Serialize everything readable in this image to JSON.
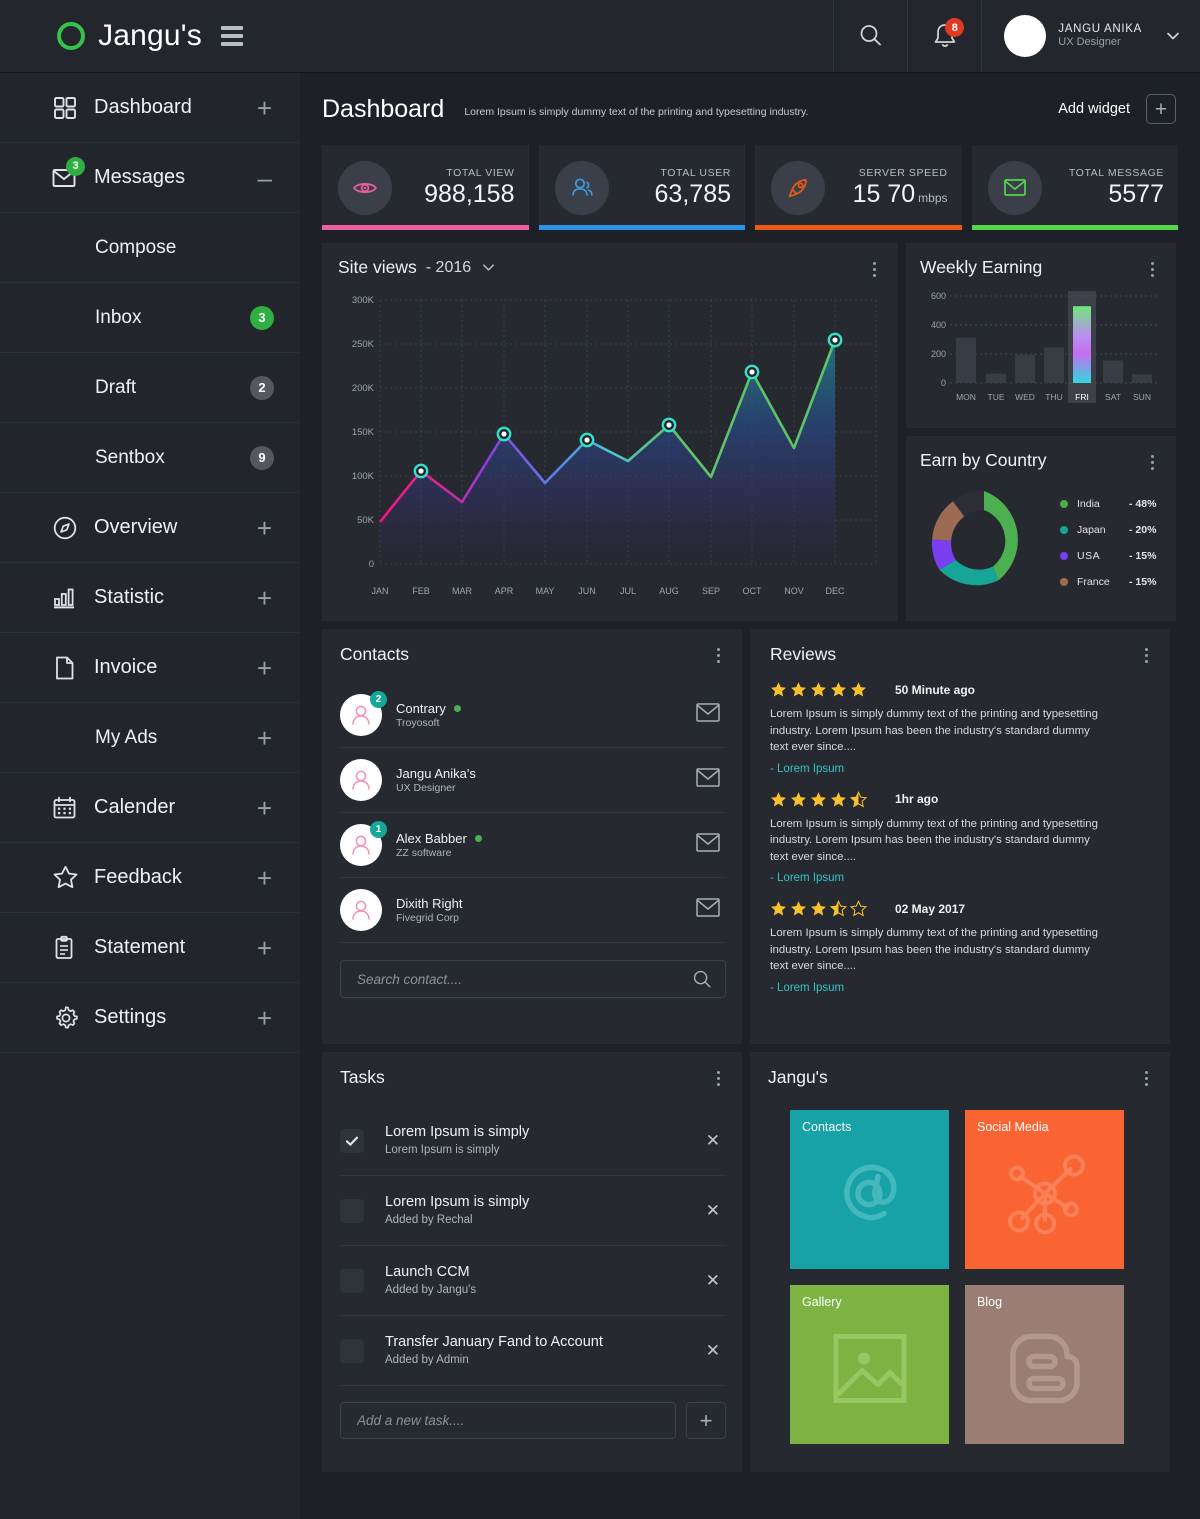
{
  "brand": {
    "name": "Jangu's",
    "logo_icon": "circle-logo",
    "menu_icon": "hamburger-icon"
  },
  "topbar": {
    "search_icon": "search-icon",
    "bell_icon": "bell-icon",
    "notification_count": "8",
    "user_name": "JANGU ANIKA",
    "user_role": "UX Designer",
    "chevron_icon": "chevron-down-icon"
  },
  "sidebar": {
    "items": [
      {
        "label": "Dashboard",
        "icon": "grid-icon",
        "action": "+"
      },
      {
        "label": "Messages",
        "icon": "envelope-icon",
        "action": "–",
        "badge": "3"
      },
      {
        "label": "Compose",
        "icon": "",
        "action": ""
      },
      {
        "label": "Inbox",
        "icon": "",
        "action": "",
        "badge": "3",
        "badge_style": "green"
      },
      {
        "label": "Draft",
        "icon": "",
        "action": "",
        "badge": "2",
        "badge_style": "grey"
      },
      {
        "label": "Sentbox",
        "icon": "",
        "action": "",
        "badge": "9",
        "badge_style": "grey"
      },
      {
        "label": "Overview",
        "icon": "compass-icon",
        "action": "+"
      },
      {
        "label": "Statistic",
        "icon": "bar-chart-icon",
        "action": "+"
      },
      {
        "label": "Invoice",
        "icon": "document-icon",
        "action": "+"
      },
      {
        "label": "My Ads",
        "icon": "",
        "action": "+"
      },
      {
        "label": "Calender",
        "icon": "calendar-icon",
        "action": "+"
      },
      {
        "label": "Feedback",
        "icon": "star-icon",
        "action": "+"
      },
      {
        "label": "Statement",
        "icon": "clipboard-icon",
        "action": "+"
      },
      {
        "label": "Settings",
        "icon": "gear-icon",
        "action": "+"
      }
    ]
  },
  "page": {
    "title": "Dashboard",
    "subtitle": "Lorem Ipsum is simply dummy text of the printing and typesetting industry.",
    "add_widget_label": "Add widget",
    "add_widget_icon": "plus-icon"
  },
  "stats": [
    {
      "label": "TOTAL VIEW",
      "value": "988,158",
      "unit": "",
      "icon": "eye-icon",
      "color": "#ef5fa0"
    },
    {
      "label": "TOTAL USER",
      "value": "63,785",
      "unit": "",
      "icon": "users-icon",
      "color": "#2b92e4"
    },
    {
      "label": "SERVER SPEED",
      "value": "15 70",
      "unit": "mbps",
      "icon": "rocket-icon",
      "color": "#ea5a16"
    },
    {
      "label": "TOTAL MESSAGE",
      "value": "5577",
      "unit": "",
      "icon": "envelope-icon",
      "color": "#56d44a"
    }
  ],
  "site_views": {
    "title": "Site views",
    "year": "- 2016",
    "dropdown_icon": "chevron-down-icon",
    "menu_icon": "kebab-menu-icon"
  },
  "weekly": {
    "title": "Weekly Earning",
    "menu_icon": "kebab-menu-icon"
  },
  "country": {
    "title": "Earn by Country",
    "menu_icon": "kebab-menu-icon"
  },
  "chart_data": [
    {
      "type": "area",
      "title": "Site views",
      "subtitle": "- 2016",
      "xlabel": "",
      "ylabel": "",
      "ylim": [
        0,
        300000
      ],
      "yticks": [
        "0",
        "50K",
        "100K",
        "150K",
        "200K",
        "250K",
        "300K"
      ],
      "grid": true,
      "categories": [
        "JAN",
        "FEB",
        "MAR",
        "APR",
        "MAY",
        "JUN",
        "JUL",
        "AUG",
        "SEP",
        "OCT",
        "NOV",
        "DEC"
      ],
      "values": [
        48000,
        105000,
        70000,
        148000,
        92000,
        141000,
        117000,
        158000,
        99000,
        218000,
        132000,
        255000
      ],
      "markers": [
        "FEB",
        "APR",
        "JUN",
        "AUG",
        "OCT",
        "DEC"
      ],
      "marker_values": [
        105000,
        148000,
        141000,
        158000,
        218000,
        255000
      ]
    },
    {
      "type": "bar",
      "title": "Weekly Earning",
      "categories": [
        "MON",
        "TUE",
        "WED",
        "THU",
        "FRI",
        "SAT",
        "SUN"
      ],
      "values": [
        320,
        65,
        195,
        245,
        530,
        155,
        60
      ],
      "highlight": "FRI",
      "ylim": [
        0,
        600
      ],
      "yticks": [
        "0",
        "200",
        "400",
        "600"
      ],
      "grid": true,
      "xlabel": "",
      "ylabel": ""
    },
    {
      "type": "pie",
      "title": "Earn by Country",
      "legend_position": "right",
      "labels": [
        "India",
        "Japan",
        "USA",
        "France"
      ],
      "values": [
        48,
        20,
        15,
        15
      ],
      "value_labels": [
        "- 48%",
        "- 20%",
        "- 15%",
        "- 15%"
      ],
      "colors": [
        "#4cb050",
        "#16a596",
        "#7b3ff2",
        "#9d6b53"
      ]
    }
  ],
  "contacts": {
    "title": "Contacts",
    "menu_icon": "kebab-menu-icon",
    "search_placeholder": "Search contact....",
    "search_icon": "search-icon",
    "mail_icon": "envelope-icon",
    "rows": [
      {
        "name": "Contrary",
        "org": "Troyosoft",
        "badge": "2",
        "online": true
      },
      {
        "name": "Jangu Anika's",
        "org": "UX Designer",
        "badge": "",
        "online": false
      },
      {
        "name": "Alex Babber",
        "org": "ZZ software",
        "badge": "1",
        "online": true
      },
      {
        "name": "Dixith Right",
        "org": "Fivegrid Corp",
        "badge": "",
        "online": false
      }
    ]
  },
  "reviews": {
    "title": "Reviews",
    "menu_icon": "kebab-menu-icon",
    "items": [
      {
        "rating": 5,
        "time": "50 Minute ago",
        "body": "Lorem Ipsum is simply dummy text of the printing and typesetting industry. Lorem Ipsum has been the industry's standard dummy text ever since....",
        "author": "- Lorem Ipsum"
      },
      {
        "rating": 4.5,
        "time": "1hr ago",
        "body": "Lorem Ipsum is simply dummy text of the printing and typesetting industry. Lorem Ipsum has been the industry's standard dummy text ever since....",
        "author": "- Lorem Ipsum"
      },
      {
        "rating": 3.5,
        "time": "02 May 2017",
        "body": "Lorem Ipsum is simply dummy text of the printing and typesetting industry. Lorem Ipsum has been the industry's standard dummy text ever since....",
        "author": "- Lorem Ipsum"
      }
    ]
  },
  "tasks": {
    "title": "Tasks",
    "menu_icon": "kebab-menu-icon",
    "add_placeholder": "Add a new task....",
    "add_icon": "plus-icon",
    "close_icon": "close-icon",
    "items": [
      {
        "name": "Lorem Ipsum is simply",
        "meta": "Lorem Ipsum is simply",
        "done": true
      },
      {
        "name": "Lorem Ipsum is simply",
        "meta": "Added by Rechal",
        "done": false
      },
      {
        "name": "Launch CCM",
        "meta": "Added by Jangu's",
        "done": false
      },
      {
        "name": "Transfer January Fand to Account",
        "meta": "Added by Admin",
        "done": false
      }
    ]
  },
  "tiles_panel": {
    "title": "Jangu's",
    "menu_icon": "kebab-menu-icon",
    "tiles": [
      {
        "label": "Contacts",
        "color": "#17a2a8",
        "icon": "at-sign-icon"
      },
      {
        "label": "Social Media",
        "color": "#fa6432",
        "icon": "network-icon"
      },
      {
        "label": "Gallery",
        "color": "#7cb342",
        "icon": "image-icon"
      },
      {
        "label": "Blog",
        "color": "#9a7d73",
        "icon": "blogger-icon"
      }
    ]
  }
}
